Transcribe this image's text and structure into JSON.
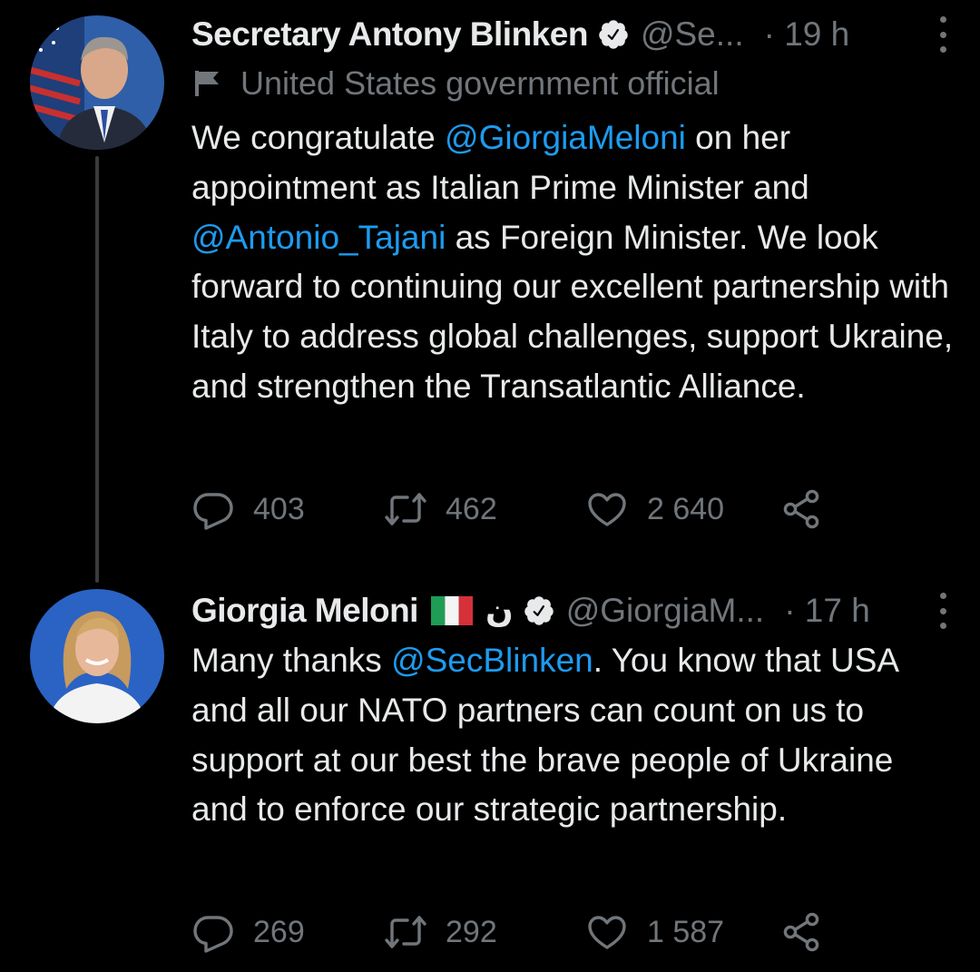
{
  "tweets": [
    {
      "author_name": "Secretary Antony Blinken",
      "handle": "@Se...",
      "time": "· 19 h",
      "label": "United States government official",
      "text_parts": [
        "We congratulate ",
        "@GiorgiaMeloni",
        " on her appointment as Italian Prime Minister and ",
        "@Antonio_Tajani",
        " as Foreign Minister. We look forward to continuing our excellent partnership with Italy to address global challenges, support Ukraine, and strengthen the Transatlantic Alliance."
      ],
      "stats": {
        "replies": "403",
        "retweets": "462",
        "likes": "2 640"
      }
    },
    {
      "author_name": "Giorgia Meloni",
      "name_suffix": "ن",
      "handle": "@GiorgiaM...",
      "time": "· 17 h",
      "text_parts": [
        "Many thanks ",
        "@SecBlinken",
        ". You know that USA and all our NATO partners can count on us to support at our best the brave people of Ukraine and to enforce our strategic partnership."
      ],
      "stats": {
        "replies": "269",
        "retweets": "292",
        "likes": "1 587"
      }
    }
  ],
  "colors": {
    "background": "#000000",
    "text": "#e7e9ea",
    "secondary": "#71767b",
    "link": "#1d9bf0"
  },
  "icons": [
    "verified-badge-icon",
    "flag-icon",
    "more-icon",
    "reply-icon",
    "retweet-icon",
    "like-icon",
    "share-icon",
    "italy-flag-emoji"
  ]
}
